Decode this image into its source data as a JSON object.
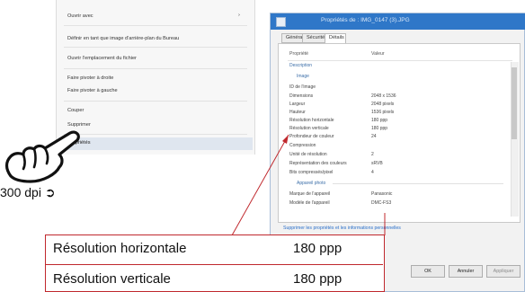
{
  "context_menu": {
    "items": [
      "Ouvrir avec",
      "Définir en tant que image d'arrière-plan du Bureau",
      "Ouvrir l'emplacement du fichier",
      "Faire pivoter à droite",
      "Faire pivoter à gauche",
      "Couper",
      "Supprimer",
      "Propriétés"
    ],
    "submenu_arrow": "›"
  },
  "callout": {
    "text": "300 dpi",
    "arrow": "➲"
  },
  "properties_window": {
    "title": "Propriétés de : IMG_0147 (3).JPG",
    "tabs": [
      "Général",
      "Sécurité",
      "Détails"
    ],
    "columns": {
      "property": "Propriété",
      "value": "Valeur"
    },
    "sections": {
      "description": "Description",
      "image": "Image",
      "camera": "Appareil photo"
    },
    "rows": [
      {
        "name": "ID de l'image",
        "value": ""
      },
      {
        "name": "Dimensions",
        "value": "2048 x 1536"
      },
      {
        "name": "Largeur",
        "value": "2048 pixels"
      },
      {
        "name": "Hauteur",
        "value": "1536 pixels"
      },
      {
        "name": "Résolution horizontale",
        "value": "180 ppp"
      },
      {
        "name": "Résolution verticale",
        "value": "180 ppp"
      },
      {
        "name": "Profondeur de couleur",
        "value": "24"
      },
      {
        "name": "Compression",
        "value": ""
      },
      {
        "name": "Unité de résolution",
        "value": "2"
      },
      {
        "name": "Représentation des couleurs",
        "value": "sRVB"
      },
      {
        "name": "Bits compressés/pixel",
        "value": "4"
      },
      {
        "name": "Marque de l'appareil",
        "value": "Panasonic"
      },
      {
        "name": "Modèle de l'appareil",
        "value": "DMC-FS3"
      }
    ],
    "link": "Supprimer les propriétés et les informations personnelles",
    "buttons": {
      "ok": "OK",
      "cancel": "Annuler",
      "apply": "Appliquer"
    }
  },
  "zoom": {
    "rows": [
      {
        "label": "Résolution horizontale",
        "value": "180 ppp"
      },
      {
        "label": "Résolution verticale",
        "value": "180 ppp"
      }
    ]
  },
  "colors": {
    "accent_red": "#c0282d",
    "title_blue": "#2f77c8"
  }
}
